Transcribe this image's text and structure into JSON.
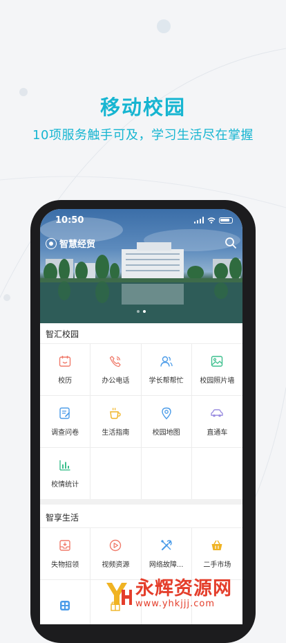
{
  "promo": {
    "title": "移动校园",
    "subtitle": "10项服务触手可及，学习生活尽在掌握"
  },
  "status_bar": {
    "time": "10:50"
  },
  "hero": {
    "logo_text": "智慧经贸",
    "carousel_count": 2,
    "carousel_active": 1
  },
  "sections": [
    {
      "title": "智汇校园",
      "items": [
        {
          "label": "校历",
          "icon": "calendar-icon",
          "color": "#f07a6a"
        },
        {
          "label": "办公电话",
          "icon": "phone-icon",
          "color": "#f07a6a"
        },
        {
          "label": "学长帮帮忙",
          "icon": "people-icon",
          "color": "#4a9be8"
        },
        {
          "label": "校园照片墙",
          "icon": "photo-icon",
          "color": "#3cbf8d"
        },
        {
          "label": "调查问卷",
          "icon": "survey-icon",
          "color": "#4a9be8"
        },
        {
          "label": "生活指南",
          "icon": "coffee-cup-icon",
          "color": "#f0b323"
        },
        {
          "label": "校园地图",
          "icon": "map-pin-icon",
          "color": "#4a9be8"
        },
        {
          "label": "直通车",
          "icon": "car-icon",
          "color": "#9b8ee0"
        },
        {
          "label": "校情统计",
          "icon": "bar-chart-icon",
          "color": "#3cbf8d"
        }
      ]
    },
    {
      "title": "智享生活",
      "items": [
        {
          "label": "失物招领",
          "icon": "inbox-icon",
          "color": "#f07a6a"
        },
        {
          "label": "视频资源",
          "icon": "play-icon",
          "color": "#f07a6a"
        },
        {
          "label": "网络故障...",
          "icon": "tools-icon",
          "color": "#4a9be8"
        },
        {
          "label": "二手市场",
          "icon": "basket-icon",
          "color": "#f0b323"
        }
      ]
    }
  ],
  "watermark": {
    "title": "永辉资源网",
    "url": "www.yhkjjj.com"
  }
}
